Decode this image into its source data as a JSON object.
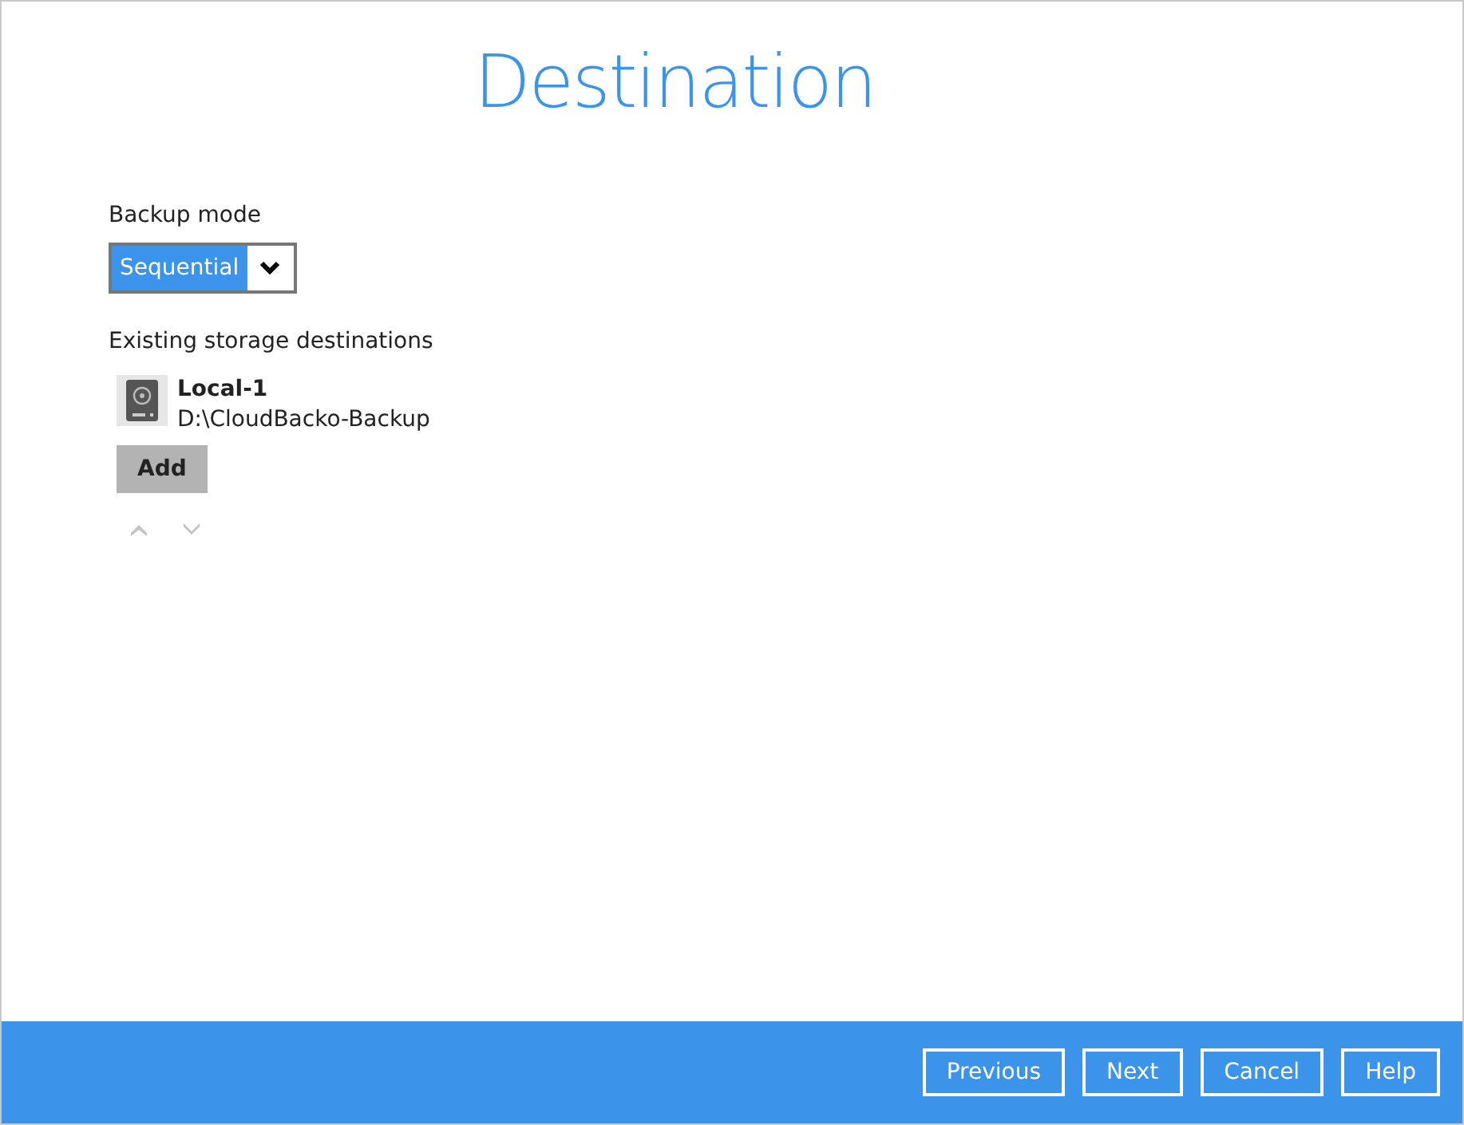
{
  "title": "Destination",
  "backup_mode": {
    "label": "Backup mode",
    "value": "Sequential"
  },
  "destinations": {
    "label": "Existing storage destinations",
    "items": [
      {
        "name": "Local-1",
        "path": "D:\\CloudBacko-Backup"
      }
    ],
    "add_button": "Add",
    "move_buttons": [
      {
        "kind": "up",
        "disabled": true
      },
      {
        "kind": "down",
        "disabled": true
      }
    ]
  },
  "footer_buttons": [
    "Previous",
    "Next",
    "Cancel",
    "Help"
  ]
}
